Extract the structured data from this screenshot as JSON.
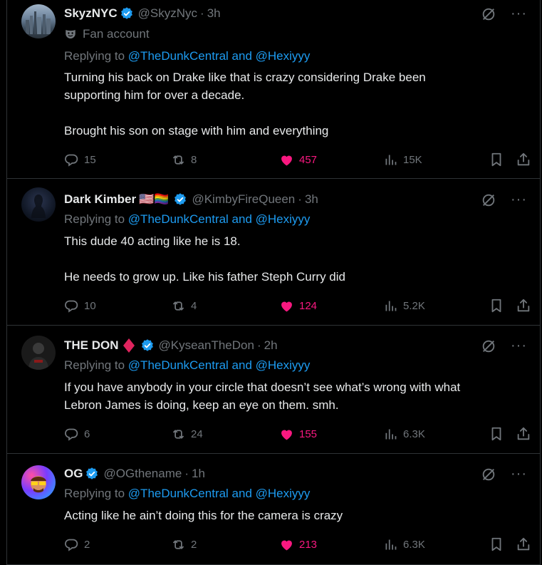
{
  "colors": {
    "accent": "#1d9bf0",
    "like": "#f91880",
    "muted": "#71767b",
    "text": "#e7e9ea",
    "divider": "#2f3336"
  },
  "tweets": [
    {
      "name": "SkyzNYC",
      "handle": "@SkyzNyc",
      "separator": "·",
      "time": "3h",
      "badge_label": "Fan account",
      "replying_prefix": "Replying to",
      "replying_to": "@TheDunkCentral and @Hexiyyy",
      "text": "Turning his back on Drake like that is crazy considering Drake been\nsupporting him for over a decade.\n\nBrought his son on stage with him and everything",
      "replies": "15",
      "reposts": "8",
      "likes": "457",
      "views": "15K"
    },
    {
      "name": "Dark Kimber",
      "flags": "🇺🇸🏳️‍🌈",
      "handle": "@KimbyFireQueen",
      "separator": "·",
      "time": "3h",
      "replying_prefix": "Replying to",
      "replying_to": "@TheDunkCentral and @Hexiyyy",
      "text": "This dude 40 acting like he is 18.\n\nHe needs to grow up. Like his father Steph Curry did",
      "replies": "10",
      "reposts": "4",
      "likes": "124",
      "views": "5.2K"
    },
    {
      "name": "THE DON",
      "handle": "@KyseanTheDon",
      "separator": "·",
      "time": "2h",
      "replying_prefix": "Replying to",
      "replying_to": "@TheDunkCentral and @Hexiyyy",
      "text": "If you have anybody in your circle that doesn’t see what’s wrong with what\nLebron James is doing, keep an eye on them. smh.",
      "replies": "6",
      "reposts": "24",
      "likes": "155",
      "views": "6.3K"
    },
    {
      "name": "OG",
      "handle": "@OGthename",
      "separator": "·",
      "time": "1h",
      "replying_prefix": "Replying to",
      "replying_to": "@TheDunkCentral and @Hexiyyy",
      "text": "Acting like he ain’t doing this for the camera is crazy",
      "replies": "2",
      "reposts": "2",
      "likes": "213",
      "views": "6.3K"
    }
  ]
}
